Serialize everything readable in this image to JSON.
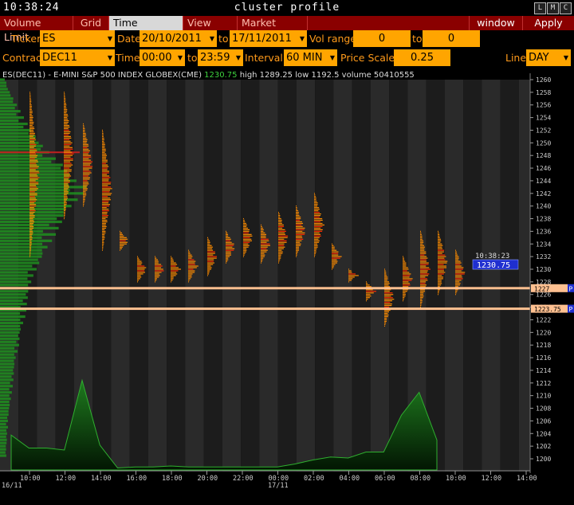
{
  "window": {
    "clock": "10:38:24",
    "title": "cluster profile",
    "buttons": [
      "L",
      "M",
      "C"
    ]
  },
  "menu": {
    "items": [
      "Volume Limit",
      "Grid",
      "Time Interval",
      "View DOM",
      "Market Watch"
    ],
    "active": "Time Interval",
    "window_label": "window",
    "apply_label": "Apply"
  },
  "controls": {
    "ticker_label": "Ticker",
    "ticker": "ES",
    "date_label": "Date",
    "date_from": "20/10/2011",
    "to1": "to",
    "date_to": "17/11/2011",
    "vol_range_label": "Vol range",
    "vol_from": "0",
    "to2": "to",
    "vol_to": "0",
    "contract_label": "Contract",
    "contract": "DEC11",
    "time_label": "Time",
    "time_from": "00:00",
    "to3": "to",
    "time_to": "23:59",
    "interval_label": "Interval",
    "interval": "60 MIN",
    "price_scale_label": "Price Scale",
    "price_scale": "0.25",
    "line_label": "Line",
    "line": "DAY"
  },
  "info": {
    "symbol": "ES(DEC11) - E-MINI S&P 500 INDEX GLOBEX(CME)",
    "last": "1230.75",
    "high": "high 1289.25",
    "low": "low 1192.5",
    "volume": "volume 50410555"
  },
  "price_axis": {
    "min": 1199,
    "max": 1261,
    "ticks": [
      "1260",
      "1258",
      "1256",
      "1254",
      "1252",
      "1250",
      "1248",
      "1246",
      "1244",
      "1242",
      "1240",
      "1238",
      "1236",
      "1234",
      "1232",
      "1230",
      "1228",
      "1226",
      "1224",
      "1222",
      "1220",
      "1218",
      "1216",
      "1214",
      "1212",
      "1210",
      "1208",
      "1206",
      "1204",
      "1202",
      "1200"
    ]
  },
  "time_axis": {
    "labels": [
      "10:00",
      "12:00",
      "14:00",
      "16:00",
      "18:00",
      "20:00",
      "22:00",
      "00:00",
      "02:00",
      "04:00",
      "06:00",
      "08:00",
      "10:00",
      "12:00",
      "14:00"
    ],
    "date_labels": [
      "16/11",
      "17/11"
    ]
  },
  "markers": {
    "last_time": "10:38:23",
    "last_price": "1230.75",
    "line1_price": "1227",
    "line1_value": 1227,
    "line2_price": "1223.75",
    "line2_value": 1223.75,
    "flag": "P"
  },
  "volume_profile": {
    "note": "hourly traded volume (relative 0-1) per bar from 10:00 16/11 to 10:00 17/11",
    "values": [
      0.35,
      0.22,
      0.22,
      0.2,
      0.9,
      0.25,
      0.02,
      0.03,
      0.03,
      0.04,
      0.03,
      0.03,
      0.03,
      0.03,
      0.03,
      0.03,
      0.06,
      0.1,
      0.13,
      0.12,
      0.18,
      0.18,
      0.55,
      0.78,
      0.3
    ]
  },
  "colors": {
    "menu_bg": "#8a0000",
    "field_bg": "#ffa500",
    "label": "#ff9a1a",
    "profile_green": "#1f8f1f",
    "cluster_orange": "#ff8c00",
    "cluster_red": "#ff2a00",
    "last_price_bg": "#1f2fd0",
    "level_line": "#ffc090"
  }
}
